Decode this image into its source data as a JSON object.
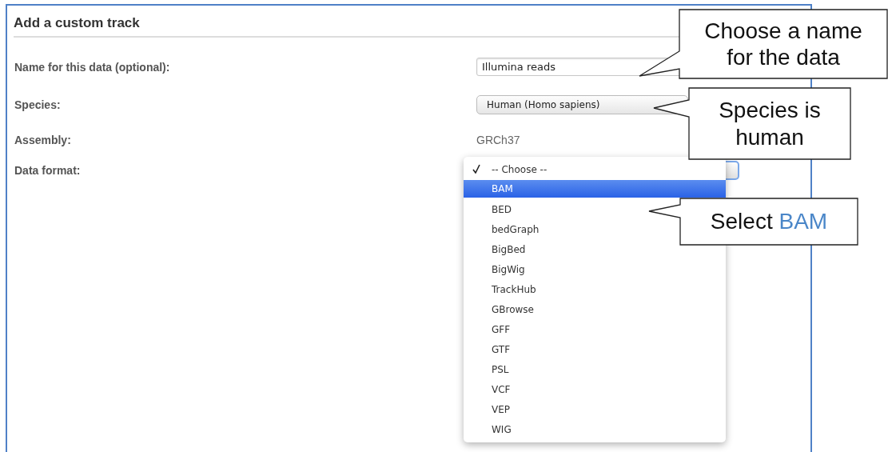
{
  "panel": {
    "title": "Add a custom track"
  },
  "fields": [
    {
      "kind": "text",
      "label": "Name for this data (optional):",
      "value": "Illumina reads"
    },
    {
      "kind": "select",
      "label": "Species:",
      "value": "Human (Homo sapiens)"
    },
    {
      "kind": "static",
      "label": "Assembly:",
      "value": "GRCh37"
    },
    {
      "kind": "menu",
      "label": "Data format:"
    }
  ],
  "format_menu": {
    "items": [
      {
        "label": "-- Choose --",
        "checked": true,
        "selected": false
      },
      {
        "label": "BAM",
        "checked": false,
        "selected": true
      },
      {
        "label": "BED",
        "checked": false,
        "selected": false
      },
      {
        "label": "bedGraph",
        "checked": false,
        "selected": false
      },
      {
        "label": "BigBed",
        "checked": false,
        "selected": false
      },
      {
        "label": "BigWig",
        "checked": false,
        "selected": false
      },
      {
        "label": "TrackHub",
        "checked": false,
        "selected": false
      },
      {
        "label": "GBrowse",
        "checked": false,
        "selected": false
      },
      {
        "label": "GFF",
        "checked": false,
        "selected": false
      },
      {
        "label": "GTF",
        "checked": false,
        "selected": false
      },
      {
        "label": "PSL",
        "checked": false,
        "selected": false
      },
      {
        "label": "VCF",
        "checked": false,
        "selected": false
      },
      {
        "label": "VEP",
        "checked": false,
        "selected": false
      },
      {
        "label": "WIG",
        "checked": false,
        "selected": false
      }
    ]
  },
  "callouts": [
    {
      "text": "Choose a name for the data"
    },
    {
      "text": "Species is human"
    },
    {
      "text": "Select",
      "highlight": "BAM"
    }
  ]
}
